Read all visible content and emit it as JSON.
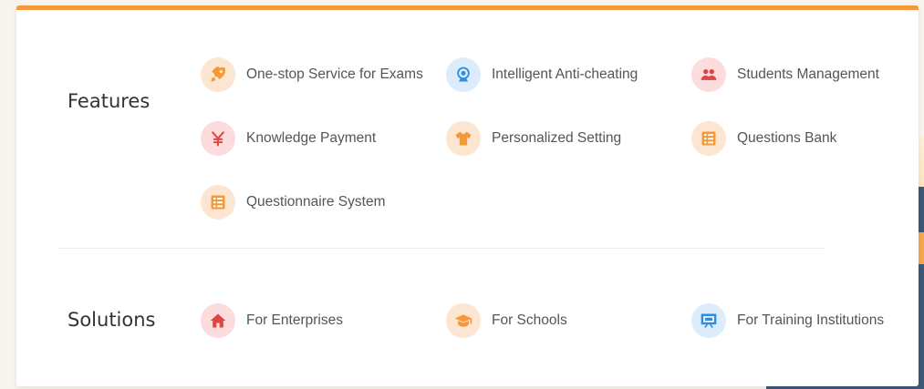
{
  "features": {
    "title": "Features",
    "items": [
      {
        "label": "One-stop Service for Exams",
        "icon": "rocket-icon",
        "color": "#f4993a"
      },
      {
        "label": "Intelligent Anti-cheating",
        "icon": "webcam-icon",
        "color": "#2b8fe0"
      },
      {
        "label": "Students Management",
        "icon": "users-icon",
        "color": "#e04545"
      },
      {
        "label": "Knowledge Payment",
        "icon": "yen-icon",
        "color": "#e04545"
      },
      {
        "label": "Personalized Setting",
        "icon": "shirt-icon",
        "color": "#f4993a"
      },
      {
        "label": "Questions Bank",
        "icon": "list-icon",
        "color": "#f4993a"
      },
      {
        "label": "Questionnaire System",
        "icon": "list-icon",
        "color": "#f4993a"
      }
    ]
  },
  "solutions": {
    "title": "Solutions",
    "items": [
      {
        "label": "For Enterprises",
        "icon": "house-icon",
        "color": "#e04545"
      },
      {
        "label": "For Schools",
        "icon": "graduation-cap-icon",
        "color": "#f4993a"
      },
      {
        "label": "For Training Institutions",
        "icon": "presentation-board-icon",
        "color": "#2b8fe0"
      }
    ]
  },
  "accent_color": "#f4993a"
}
